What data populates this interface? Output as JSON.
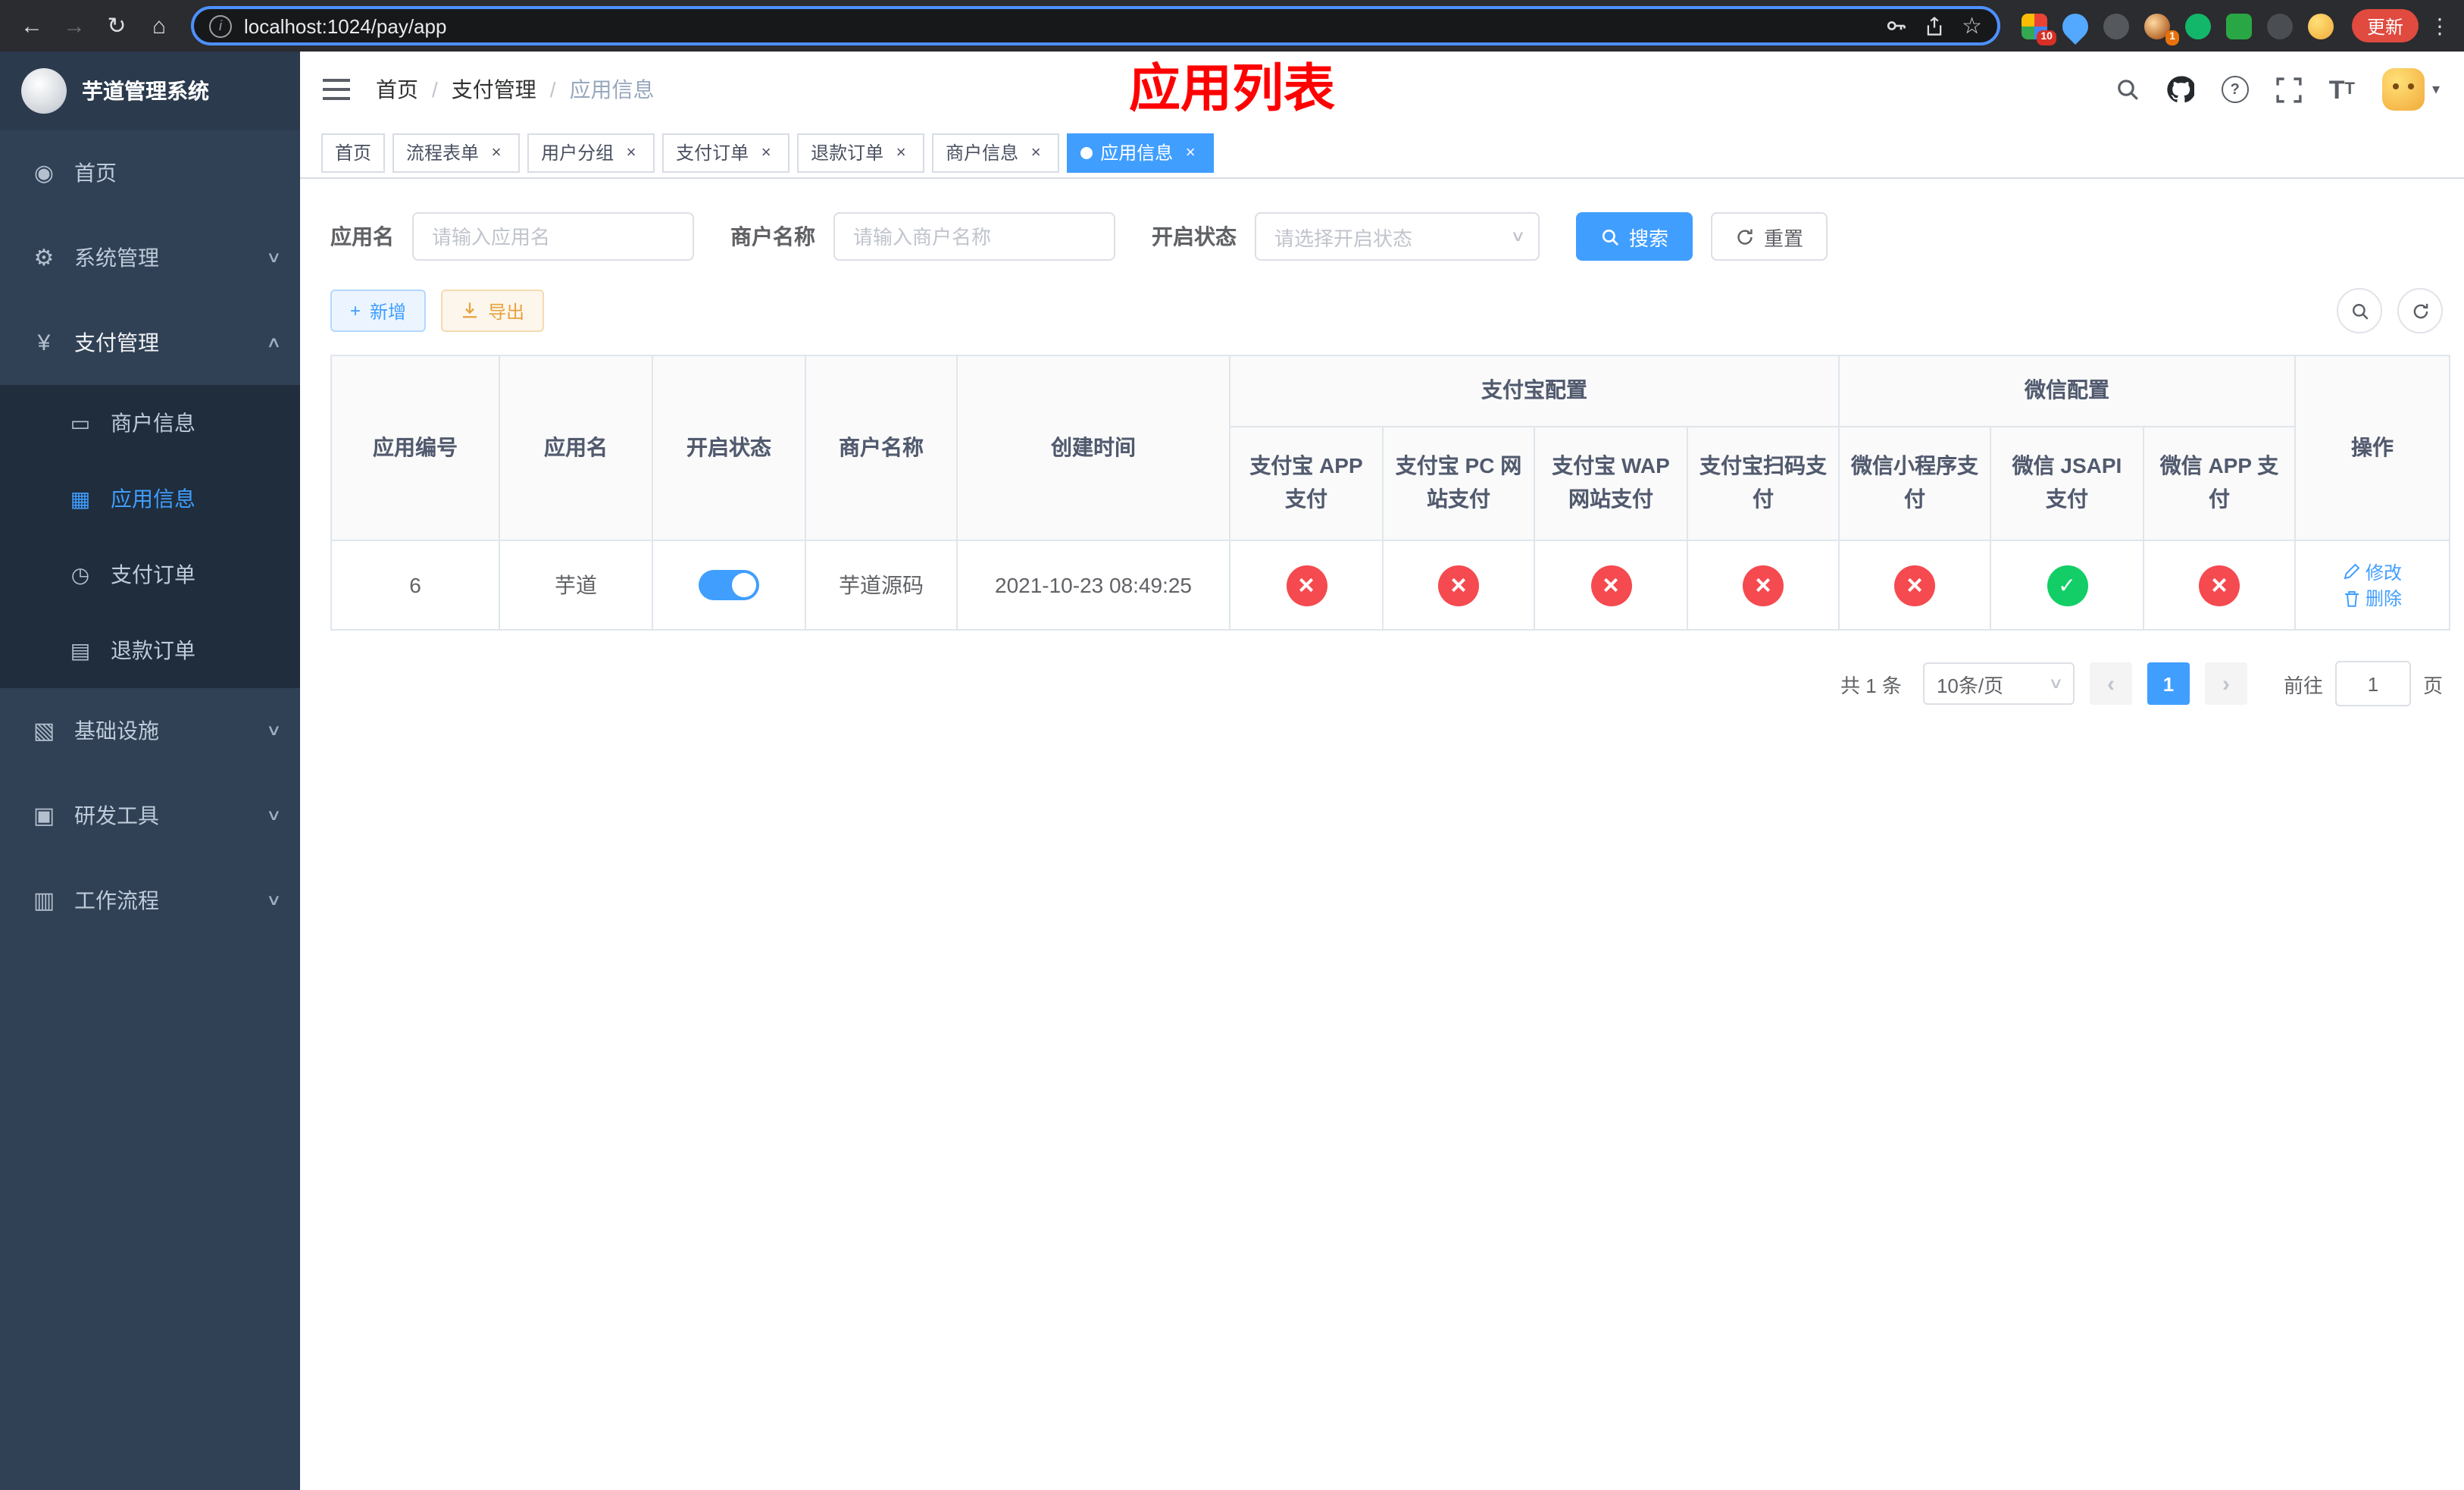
{
  "browser": {
    "url": "localhost:1024/pay/app",
    "update_label": "更新",
    "ext_badge_grid": "10",
    "ext_badge_avatar": "1"
  },
  "icons": {
    "back": "←",
    "forward": "→",
    "reload": "↻",
    "home": "⌂",
    "star": "☆",
    "kebab": "⋮",
    "info": "i",
    "dashboard": "◉",
    "gear": "⚙",
    "yen": "¥",
    "card": "▭",
    "grid": "▦",
    "clock": "◷",
    "doc": "▤",
    "infra": "▧",
    "tools": "▣",
    "flow": "▥",
    "chevron_down": "∨",
    "chevron_up": "∧",
    "help": "?",
    "caret_down": "▾",
    "plus": "+",
    "close": "×",
    "prev": "‹",
    "next": "›",
    "font_size_big": "T",
    "font_size_small": "T"
  },
  "sidebar": {
    "title": "芋道管理系统",
    "home": "首页",
    "system": "系统管理",
    "payment": "支付管理",
    "merchant_info": "商户信息",
    "app_info": "应用信息",
    "pay_order": "支付订单",
    "refund_order": "退款订单",
    "infra": "基础设施",
    "dev_tools": "研发工具",
    "workflow": "工作流程"
  },
  "navbar": {
    "breadcrumb_home": "首页",
    "breadcrumb_parent": "支付管理",
    "breadcrumb_current": "应用信息",
    "annotation": "应用列表"
  },
  "tags": [
    {
      "label": "首页"
    },
    {
      "label": "流程表单"
    },
    {
      "label": "用户分组"
    },
    {
      "label": "支付订单"
    },
    {
      "label": "退款订单"
    },
    {
      "label": "商户信息"
    },
    {
      "label": "应用信息"
    }
  ],
  "filters": {
    "app_name_label": "应用名",
    "app_name_placeholder": "请输入应用名",
    "merchant_label": "商户名称",
    "merchant_placeholder": "请输入商户名称",
    "status_label": "开启状态",
    "status_placeholder": "请选择开启状态",
    "search_label": "搜索",
    "reset_label": "重置"
  },
  "toolbar": {
    "add_label": "新增",
    "export_label": "导出"
  },
  "table": {
    "headers": {
      "app_id": "应用编号",
      "app_name": "应用名",
      "status": "开启状态",
      "merchant": "商户名称",
      "create_time": "创建时间",
      "alipay_group": "支付宝配置",
      "wechat_group": "微信配置",
      "alipay_app": "支付宝 APP 支付",
      "alipay_pc": "支付宝 PC 网站支付",
      "alipay_wap": "支付宝 WAP 网站支付",
      "alipay_qr": "支付宝扫码支付",
      "wechat_mini": "微信小程序支付",
      "wechat_jsapi": "微信 JSAPI 支付",
      "wechat_app": "微信 APP 支付",
      "actions": "操作"
    },
    "rows": [
      {
        "app_id": "6",
        "app_name": "芋道",
        "status": "on",
        "merchant": "芋道源码",
        "create_time": "2021-10-23 08:49:25",
        "alipay_app": "fail",
        "alipay_pc": "fail",
        "alipay_wap": "fail",
        "alipay_qr": "fail",
        "wechat_mini": "fail",
        "wechat_jsapi": "success",
        "wechat_app": "fail",
        "edit_label": "修改",
        "delete_label": "删除"
      }
    ]
  },
  "pagination": {
    "total_text": "共 1 条",
    "page_size": "10条/页",
    "current_page": "1",
    "goto_label": "前往",
    "goto_value": "1",
    "page_suffix": "页"
  },
  "colors": {
    "primary": "#409EFF",
    "success": "#13ce66",
    "danger": "#f54a4f",
    "warning": "#e6a23c",
    "sidebar_bg": "#304156",
    "submenu_bg": "#1f2d3d",
    "annotation_red": "#ff0000"
  }
}
